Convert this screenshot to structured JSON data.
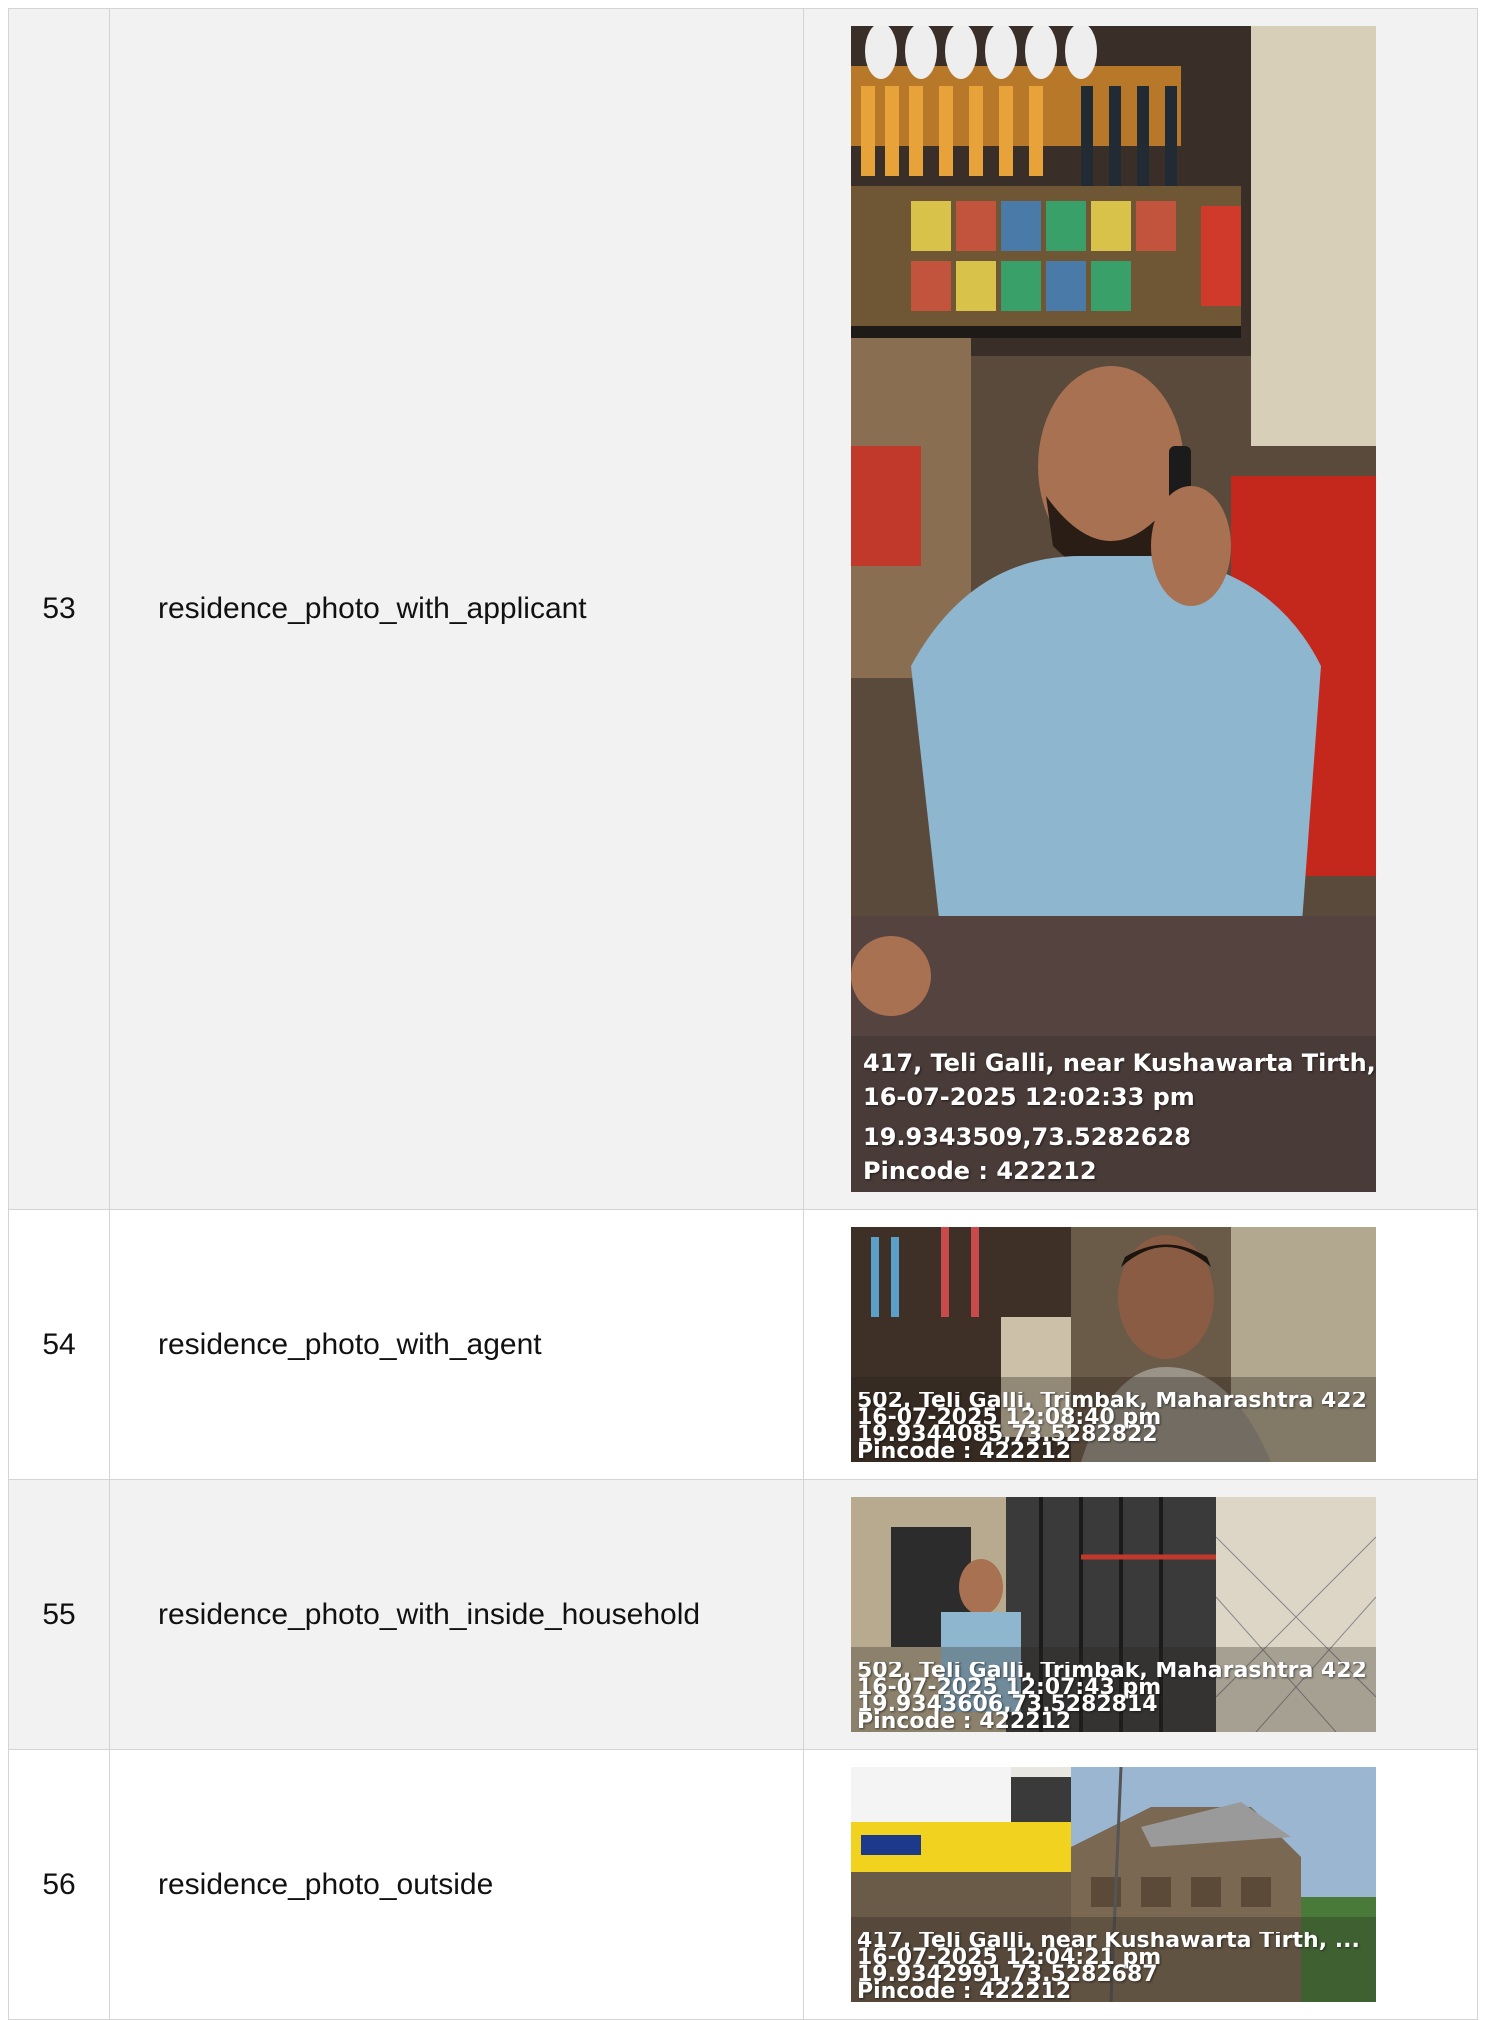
{
  "rows": [
    {
      "num": "53",
      "name": "residence_photo_with_applicant",
      "photo": {
        "kind": "shop-interior-portrait",
        "address": "417, Teli Galli, near Kushawarta Tirth, ...",
        "datetime": "16-07-2025 12:02:33 pm",
        "coords": "19.9343509,73.5282628",
        "pincode": "Pincode : 422212"
      }
    },
    {
      "num": "54",
      "name": "residence_photo_with_agent",
      "photo": {
        "kind": "street-selfie",
        "address": "502, Teli Galli, Trimbak, Maharashtra 422",
        "datetime": "16-07-2025 12:08:40 pm",
        "coords": "19.9344085,73.5282822",
        "pincode": "Pincode : 422212"
      }
    },
    {
      "num": "55",
      "name": "residence_photo_with_inside_household",
      "photo": {
        "kind": "house-entrance",
        "address": "502, Teli Galli, Trimbak, Maharashtra 422",
        "datetime": "16-07-2025 12:07:43 pm",
        "coords": "19.9343606,73.5282814",
        "pincode": "Pincode : 422212"
      }
    },
    {
      "num": "56",
      "name": "residence_photo_outside",
      "photo": {
        "kind": "street-exterior",
        "address": "417, Teli Galli, near Kushawarta Tirth, ...",
        "datetime": "16-07-2025 12:04:21 pm",
        "coords": "19.9342991,73.5282687",
        "pincode": "Pincode : 422212"
      }
    }
  ]
}
